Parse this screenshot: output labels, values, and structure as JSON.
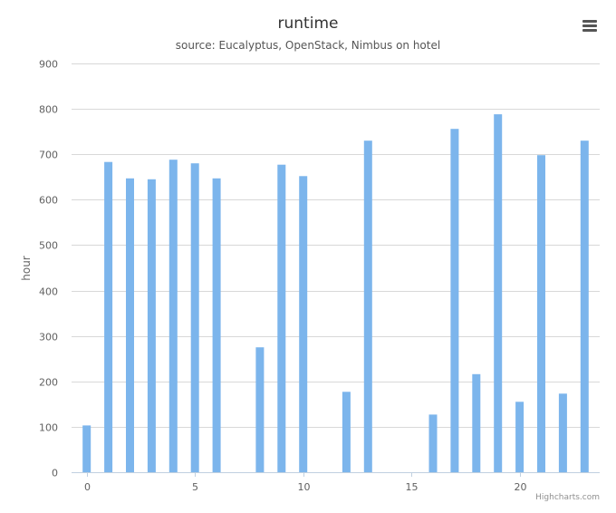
{
  "chart_data": {
    "type": "bar",
    "title": "runtime",
    "subtitle": "source: Eucalyptus, OpenStack, Nimbus on hotel",
    "xlabel": "",
    "ylabel": "hour",
    "x": [
      0,
      1,
      2,
      3,
      4,
      5,
      6,
      7,
      8,
      9,
      10,
      11,
      12,
      13,
      14,
      15,
      16,
      17,
      18,
      19,
      20,
      21,
      22,
      23
    ],
    "values": [
      103,
      683,
      647,
      645,
      688,
      680,
      647,
      0,
      275,
      677,
      652,
      0,
      177,
      730,
      0,
      0,
      127,
      756,
      216,
      788,
      155,
      698,
      173,
      730
    ],
    "xlim": [
      -0.7,
      23.7
    ],
    "ylim": [
      0,
      900
    ],
    "x_ticks": [
      0,
      5,
      10,
      15,
      20
    ],
    "y_ticks": [
      0,
      100,
      200,
      300,
      400,
      500,
      600,
      700,
      800,
      900
    ],
    "grid": true,
    "legend": "none",
    "bar_color": "#7cb5ec"
  },
  "ui": {
    "menu_icon": "hamburger-menu-icon",
    "credits": "Highcharts.com"
  }
}
